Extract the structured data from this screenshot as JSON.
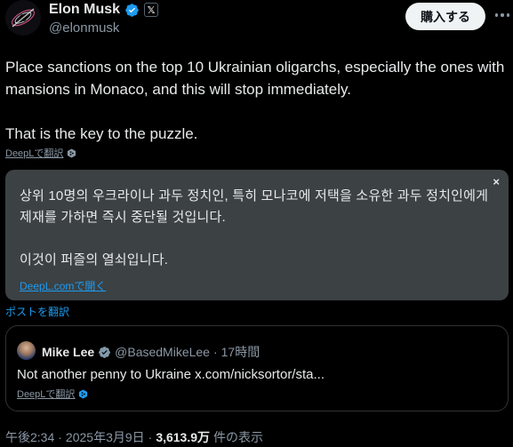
{
  "author": {
    "display_name": "Elon Musk",
    "handle": "@elonmusk",
    "verified_color": "#1d9bf0",
    "affiliate_badge": "𝕏"
  },
  "header": {
    "subscribe_label": "購入する"
  },
  "tweet": {
    "text": "Place sanctions on the top 10 Ukrainian oligarchs, especially the ones with mansions in Monaco, and this will stop immediately.\n\nThat is the key to the puzzle.",
    "deepl_label": "DeepLで翻訳"
  },
  "translation": {
    "close_label": "×",
    "text": "상위 10명의 우크라이나 과두 정치인, 특히 모나코에 저택을 소유한 과두 정치인에게 제재를 가하면 즉시 중단될 것입니다.\n\n이것이 퍼즐의 열쇠입니다.",
    "open_link": "DeepL.comで開く",
    "background": "#3c4143"
  },
  "translate_post_label": "ポストを翻訳",
  "quote": {
    "display_name": "Mike Lee",
    "handle": "@BasedMikeLee",
    "separator": "·",
    "time": "17時間",
    "text": "Not another penny to Ukraine x.com/nicksortor/sta...",
    "deepl_label": "DeepLで翻訳"
  },
  "meta": {
    "time": "午後2:34",
    "separator": "·",
    "date": "2025年3月9日",
    "separator2": "·",
    "views": "3,613.9万",
    "views_suffix": "件の表示"
  },
  "colors": {
    "background": "#000000",
    "text": "#e7e9ea",
    "muted": "#8b98a5",
    "link": "#1d9bf0"
  }
}
